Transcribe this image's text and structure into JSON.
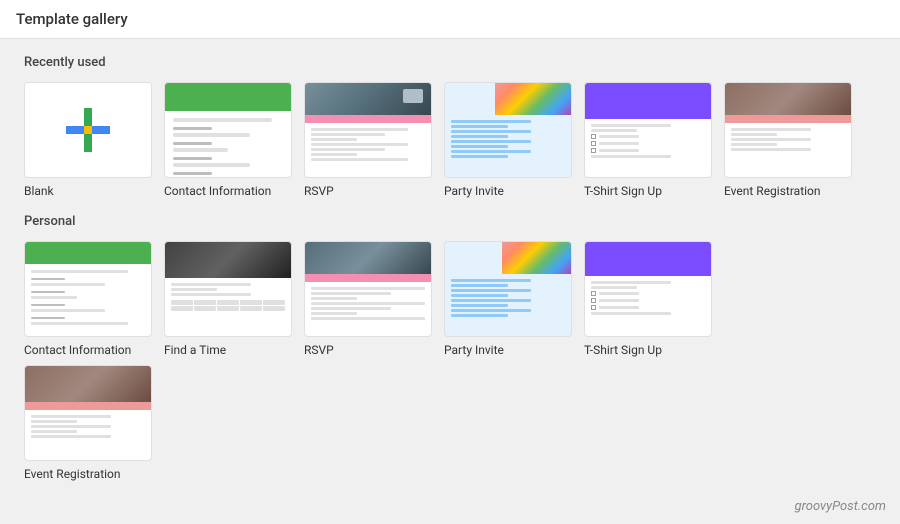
{
  "header": {
    "title": "Template gallery"
  },
  "sections": {
    "recently_used": {
      "label": "Recently used",
      "templates": [
        {
          "id": "blank",
          "label": "Blank"
        },
        {
          "id": "contact-info",
          "label": "Contact Information"
        },
        {
          "id": "rsvp",
          "label": "RSVP"
        },
        {
          "id": "party-invite",
          "label": "Party Invite"
        },
        {
          "id": "tshirt-signup",
          "label": "T-Shirt Sign Up"
        },
        {
          "id": "event-registration",
          "label": "Event Registration"
        }
      ]
    },
    "personal": {
      "label": "Personal",
      "templates": [
        {
          "id": "contact-info-2",
          "label": "Contact Information"
        },
        {
          "id": "find-a-time",
          "label": "Find a Time"
        },
        {
          "id": "rsvp-2",
          "label": "RSVP"
        },
        {
          "id": "party-invite-2",
          "label": "Party Invite"
        },
        {
          "id": "tshirt-signup-2",
          "label": "T-Shirt Sign Up"
        },
        {
          "id": "event-registration-2",
          "label": "Event Registration"
        }
      ]
    }
  },
  "watermark": "groovyPost.com"
}
